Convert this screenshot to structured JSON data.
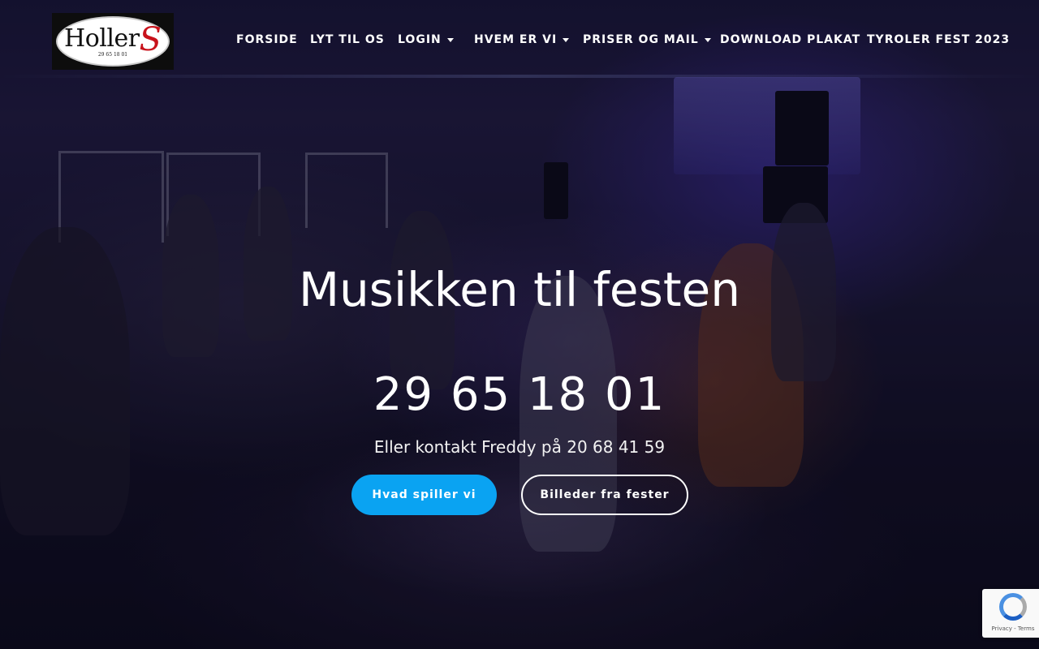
{
  "brand": {
    "logo_main": "Holler",
    "logo_accent": "S",
    "logo_phone": "29 65 18 01"
  },
  "nav": {
    "items": [
      {
        "label": "FORSIDE",
        "has_dropdown": false
      },
      {
        "label": "LYT TIL OS",
        "has_dropdown": false
      },
      {
        "label": "LOGIN",
        "has_dropdown": true
      },
      {
        "label": "HVEM ER VI",
        "has_dropdown": true
      },
      {
        "label": "PRISER OG MAIL",
        "has_dropdown": true
      },
      {
        "label": "DOWNLOAD PLAKAT",
        "has_dropdown": false
      },
      {
        "label": "TYROLER FEST 2023",
        "has_dropdown": false
      }
    ]
  },
  "hero": {
    "headline": "Musikken til festen",
    "phone": "29 65 18 01",
    "subline": "Eller kontakt Freddy på 20 68 41 59",
    "buttons": {
      "primary_label": "Hvad spiller vi",
      "secondary_label": "Billeder fra fester"
    }
  },
  "recaptcha": {
    "terms_text": "Privacy - Terms"
  },
  "colors": {
    "accent": "#0aa3f2",
    "logo_red": "#c8121b",
    "text": "#ffffff"
  }
}
